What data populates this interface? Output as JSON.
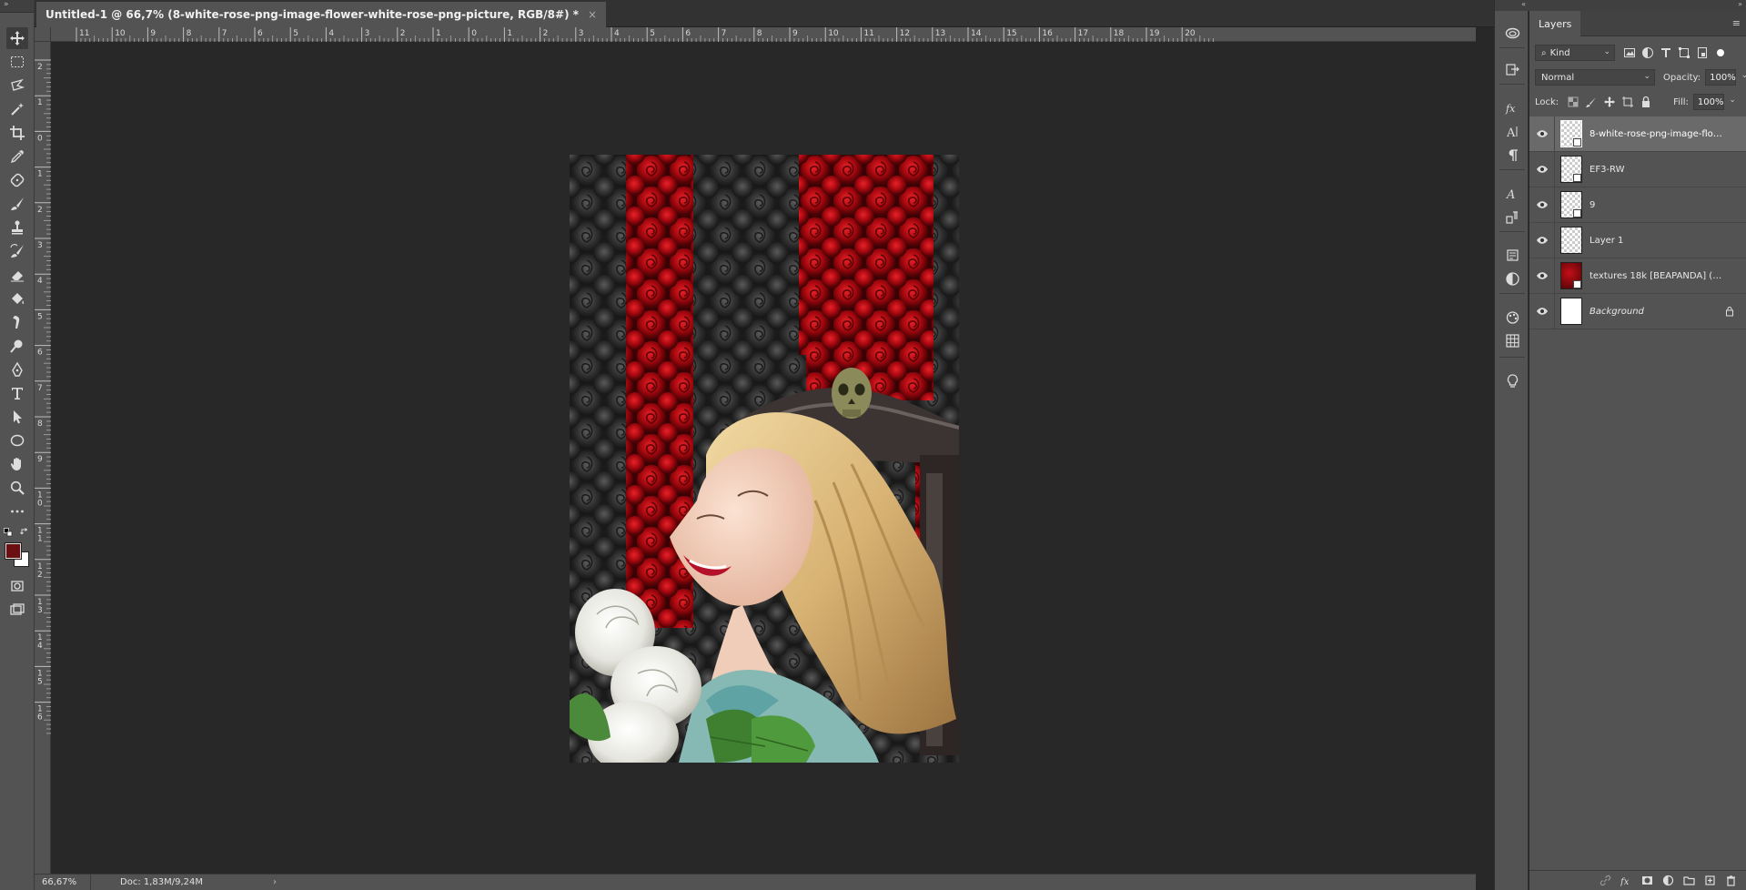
{
  "document_tab": {
    "title": "Untitled-1 @ 66,7% (8-white-rose-png-image-flower-white-rose-png-picture, RGB/8#) *",
    "close": "×"
  },
  "colors": {
    "foreground": "#6b0f12",
    "background": "#ffffff",
    "canvas_bg": "#282828",
    "panel_bg": "#535353"
  },
  "tools": [
    {
      "name": "move-tool-icon"
    },
    {
      "name": "marquee-tool-icon"
    },
    {
      "name": "lasso-tool-icon"
    },
    {
      "name": "magic-wand-icon"
    },
    {
      "name": "crop-tool-icon"
    },
    {
      "name": "eyedropper-icon"
    },
    {
      "name": "healing-brush-icon"
    },
    {
      "name": "brush-tool-icon"
    },
    {
      "name": "clone-stamp-icon"
    },
    {
      "name": "history-brush-icon"
    },
    {
      "name": "eraser-icon"
    },
    {
      "name": "paint-bucket-icon"
    },
    {
      "name": "smudge-tool-icon"
    },
    {
      "name": "dodge-tool-icon"
    },
    {
      "name": "pen-tool-icon"
    },
    {
      "name": "type-tool-icon"
    },
    {
      "name": "path-selection-icon"
    },
    {
      "name": "ellipse-tool-icon"
    },
    {
      "name": "hand-tool-icon"
    },
    {
      "name": "zoom-tool-icon"
    },
    {
      "name": "more-tools-icon"
    }
  ],
  "ruler_h_ticks": [
    "11",
    "10",
    "9",
    "8",
    "7",
    "6",
    "5",
    "4",
    "3",
    "2",
    "1",
    "0",
    "1",
    "2",
    "3",
    "4",
    "5",
    "6",
    "7",
    "8",
    "9",
    "10",
    "11",
    "12",
    "13",
    "14",
    "15",
    "16",
    "17",
    "18",
    "19",
    "20"
  ],
  "ruler_v_ticks": [
    "2",
    "1",
    "0",
    "1",
    "2",
    "3",
    "4",
    "5",
    "6",
    "7",
    "8",
    "9",
    "1 0",
    "1 1",
    "1 2",
    "1 3",
    "1 4",
    "1 5",
    "1 6"
  ],
  "status": {
    "zoom": "66,67%",
    "doc": "Doc: 1,83M/9,24M",
    "arrow": "›"
  },
  "layers_panel": {
    "tab": "Layers",
    "filter_kind": "Kind",
    "blend_mode": "Normal",
    "opacity_label": "Opacity:",
    "opacity_value": "100%",
    "lock_label": "Lock:",
    "fill_label": "Fill:",
    "fill_value": "100%",
    "layers": [
      {
        "name": "8-white-rose-png-image-flow...",
        "selected": true,
        "thumb": "checker",
        "smart": true
      },
      {
        "name": "EF3-RW",
        "selected": false,
        "thumb": "checker",
        "smart": true
      },
      {
        "name": "9",
        "selected": false,
        "thumb": "checker",
        "smart": true
      },
      {
        "name": "Layer 1",
        "selected": false,
        "thumb": "checker",
        "smart": false
      },
      {
        "name": "textures 18k [BEAPANDA] (2...",
        "selected": false,
        "thumb": "texture",
        "smart": true
      },
      {
        "name": "Background",
        "selected": false,
        "thumb": "white",
        "smart": false,
        "locked": true
      }
    ]
  }
}
